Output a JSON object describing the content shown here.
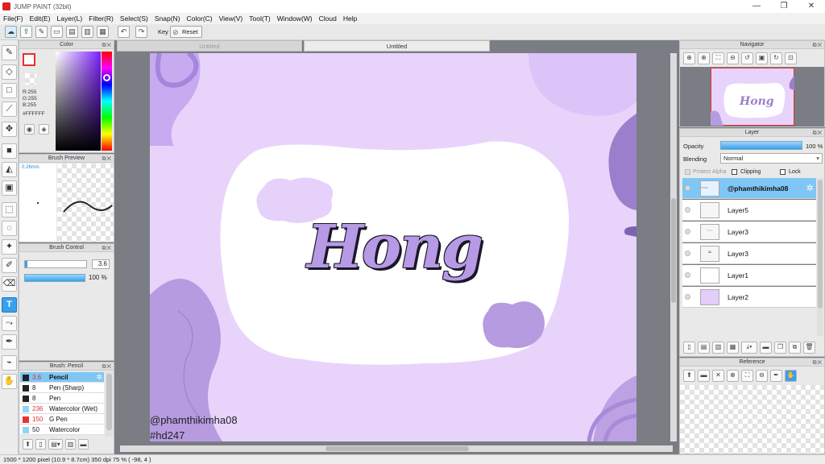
{
  "window": {
    "title": "JUMP PAINT (32bit)",
    "controls": [
      "—",
      "❐",
      "✕"
    ]
  },
  "menu": [
    "File(F)",
    "Edit(E)",
    "Layer(L)",
    "Filter(R)",
    "Select(S)",
    "Snap(N)",
    "Color(C)",
    "View(V)",
    "Tool(T)",
    "Window(W)",
    "Cloud",
    "Help"
  ],
  "toolbar": {
    "key_label": "Key",
    "reset_label": "Reset"
  },
  "color_panel": {
    "title": "Color",
    "r": "R:255",
    "g": "G:255",
    "b": "B:255",
    "hex": "#FFFFFF"
  },
  "brush_preview": {
    "title": "Brush Preview",
    "size": "0.26mm"
  },
  "brush_control": {
    "title": "Brush Control",
    "size": "3.6",
    "opacity": "100 %"
  },
  "brush_list": {
    "title": "Brush: Pencil",
    "items": [
      {
        "size": "3.6",
        "name": "Pencil",
        "swatch": "#222222"
      },
      {
        "size": "8",
        "name": "Pen (Sharp)",
        "swatch": "#222222"
      },
      {
        "size": "8",
        "name": "Pen",
        "swatch": "#222222"
      },
      {
        "size": "236",
        "name": "Watercolor (Wet)",
        "swatch": "#8fd6f5"
      },
      {
        "size": "150",
        "name": "G Pen",
        "swatch": "#e83333"
      },
      {
        "size": "50",
        "name": "Watercolor",
        "swatch": "#8fd6f5"
      }
    ]
  },
  "tabs": [
    "Untitled",
    "Untitled"
  ],
  "artwork": {
    "word": "Hong",
    "credit": "@phamthikimha08",
    "tag": "#hd247"
  },
  "navigator": {
    "title": "Navigator"
  },
  "layer_panel": {
    "title": "Layer",
    "opacity_label": "Opacity",
    "opacity_value": "100 %",
    "blending_label": "Blending",
    "blending_value": "Normal",
    "protect_alpha": "Protect Alpha",
    "clipping": "Clipping",
    "lock": "Lock",
    "layers": [
      "@phamthikimha08",
      "Layer5",
      "Layer3",
      "Layer3",
      "Layer1",
      "Layer2"
    ]
  },
  "reference": {
    "title": "Reference"
  },
  "status": {
    "text": "1500 * 1200 pixel   (10.9 * 8.7cm)   350 dpi   75 %   ( -98, 4 )"
  },
  "colors": {
    "accent": "#39a0ee",
    "canvas_bg": "#e8d4fb",
    "lavender": "#b79be0",
    "purple_dark": "#8f72c4"
  }
}
